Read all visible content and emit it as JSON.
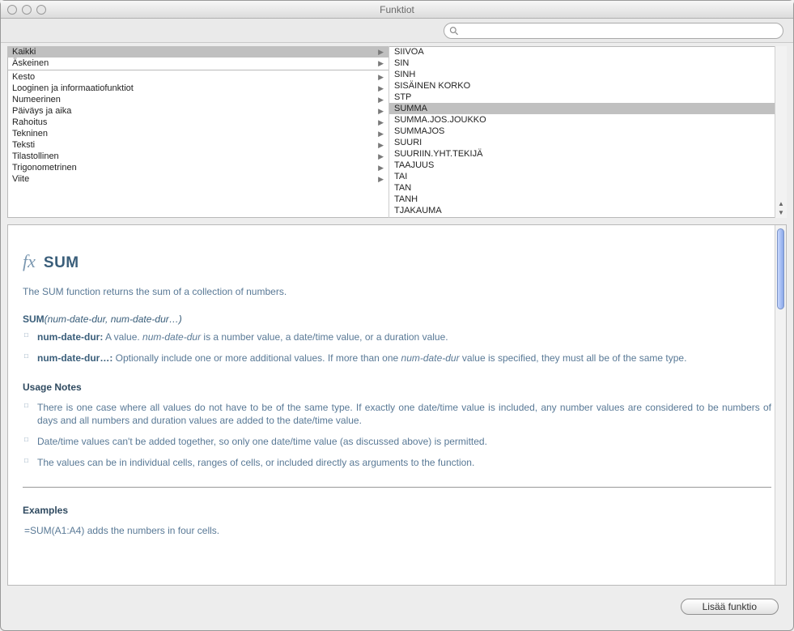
{
  "window": {
    "title": "Funktiot"
  },
  "search": {
    "placeholder": ""
  },
  "categories": {
    "groups": [
      [
        "Kaikki",
        "Äskeinen"
      ],
      [
        "Kesto",
        "Looginen ja informaatiofunktiot",
        "Numeerinen",
        "Päiväys ja aika",
        "Rahoitus",
        "Tekninen",
        "Teksti",
        "Tilastollinen",
        "Trigonometrinen",
        "Viite"
      ]
    ],
    "selected": "Kaikki"
  },
  "functions": {
    "visible": [
      "SIIVOA",
      "SIN",
      "SINH",
      "SISÄINEN KORKO",
      "STP",
      "SUMMA",
      "SUMMA.JOS.JOUKKO",
      "SUMMAJOS",
      "SUURI",
      "SUURIIN.YHT.TEKIJÄ",
      "TAAJUUS",
      "TAI",
      "TAN",
      "TANH",
      "TJAKAUMA"
    ],
    "selected": "SUMMA"
  },
  "detail": {
    "fx_label": "fx",
    "name": "SUM",
    "description": "The SUM function returns the sum of a collection of numbers.",
    "signature_name": "SUM",
    "signature_params": "(num-date-dur, num-date-dur…)",
    "params": [
      {
        "name": "num-date-dur:",
        "text_before": "A value. ",
        "ital": "num-date-dur",
        "text_after": " is a number value, a date/time value, or a duration value."
      },
      {
        "name": "num-date-dur…:",
        "text_before": "Optionally include one or more additional values. If more than one ",
        "ital": "num-date-dur",
        "text_after": " value is specified, they must all be of the same type."
      }
    ],
    "usage_title": "Usage Notes",
    "notes": [
      "There is one case where all values do not have to be of the same type. If exactly one date/time value is included, any number values are considered to be numbers of days and all numbers and duration values are added to the date/time value.",
      "Date/time values can't be added together, so only one date/time value (as discussed above) is permitted.",
      "The values can be in individual cells, ranges of cells, or included directly as arguments to the function."
    ],
    "examples_title": "Examples",
    "examples": [
      "=SUM(A1:A4) adds the numbers in four cells."
    ]
  },
  "footer": {
    "add_button": "Lisää funktio"
  }
}
